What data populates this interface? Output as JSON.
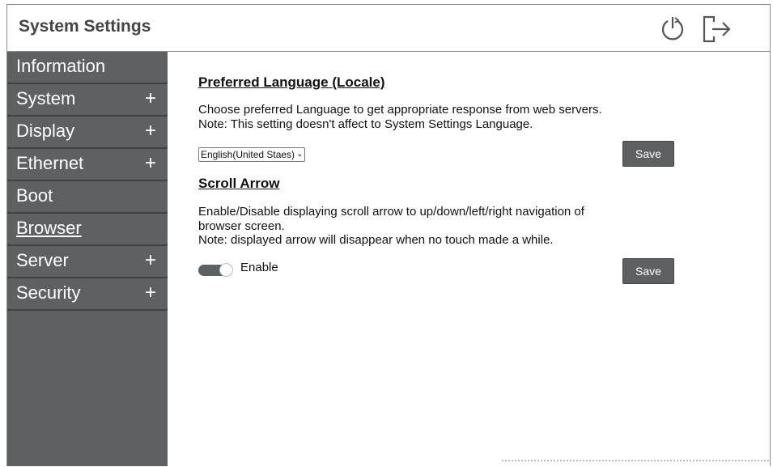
{
  "header": {
    "title": "System Settings",
    "power_icon": "power-icon",
    "logout_icon": "logout-icon"
  },
  "sidebar": {
    "items": [
      {
        "label": "Information",
        "plus": ""
      },
      {
        "label": "System",
        "plus": "+"
      },
      {
        "label": "Display",
        "plus": "+"
      },
      {
        "label": "Ethernet",
        "plus": "+"
      },
      {
        "label": "Boot",
        "plus": ""
      },
      {
        "label": "Browser",
        "plus": ""
      },
      {
        "label": "Server",
        "plus": "+"
      },
      {
        "label": "Security",
        "plus": "+"
      }
    ]
  },
  "language": {
    "title": "Preferred Language (Locale)",
    "desc_line1": "Choose preferred Language to get appropriate response from web servers.",
    "desc_line2": "Note: This setting doesn't affect to System Settings Language.",
    "selected": "English(United Staes)",
    "save_label": "Save"
  },
  "scroll_arrow": {
    "title": "Scroll Arrow",
    "desc_line1": "Enable/Disable displaying scroll arrow to up/down/left/right navigation of",
    "desc_line2": "browser screen.",
    "desc_line3": "Note: displayed arrow will disappear when no touch made a while.",
    "toggle_label": "Enable",
    "toggle_on": true,
    "save_label": "Save"
  },
  "colors": {
    "sidebar_bg": "#5e6062",
    "button_bg": "#5e6062",
    "title_color": "#444444"
  }
}
